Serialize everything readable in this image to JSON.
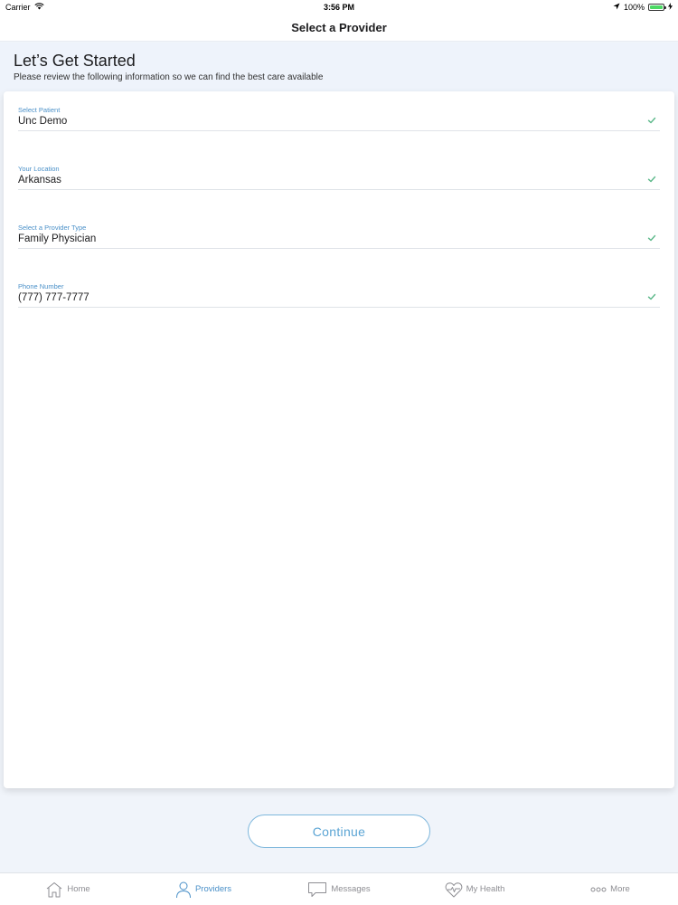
{
  "status_bar": {
    "carrier": "Carrier",
    "time": "3:56 PM",
    "battery_percent": "100%",
    "battery_level": 1.0
  },
  "nav": {
    "title": "Select a Provider"
  },
  "header": {
    "title": "Let’s Get Started",
    "subtitle": "Please review the following information so we can find the best care available"
  },
  "fields": [
    {
      "label": "Select Patient",
      "value": "Unc Demo"
    },
    {
      "label": "Your Location",
      "value": "Arkansas"
    },
    {
      "label": "Select a Provider Type",
      "value": "Family Physician"
    },
    {
      "label": "Phone Number",
      "value": "(777) 777-7777"
    }
  ],
  "continue_label": "Continue",
  "tabs": [
    {
      "label": "Home",
      "icon": "home-icon",
      "active": false
    },
    {
      "label": "Providers",
      "icon": "person-icon",
      "active": true
    },
    {
      "label": "Messages",
      "icon": "message-icon",
      "active": false
    },
    {
      "label": "My Health",
      "icon": "heart-pulse-icon",
      "active": false
    },
    {
      "label": "More",
      "icon": "more-dots-icon",
      "active": false
    }
  ],
  "colors": {
    "accent": "#4a90c8",
    "check": "#5cb88a",
    "background": "#f0f4fa"
  }
}
